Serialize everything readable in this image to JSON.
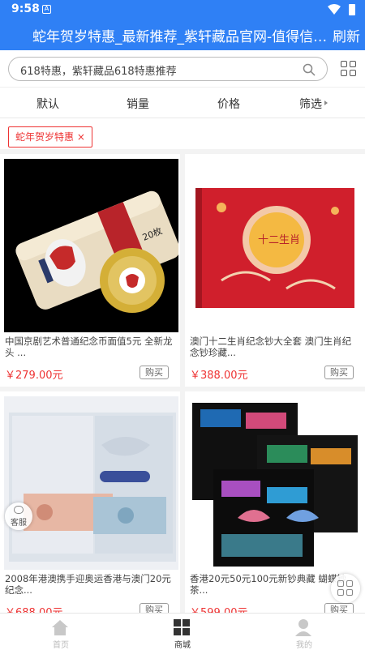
{
  "status_bar": {
    "time": "9:58"
  },
  "app_bar": {
    "title": "蛇年贺岁特惠_最新推荐_紫轩藏品官网-值得信赖的...",
    "refresh_label": "刷新"
  },
  "search": {
    "value": "618特惠，紫轩藏品618特惠推荐"
  },
  "sort_options": [
    "默认",
    "销量",
    "价格",
    "筛选"
  ],
  "filter_chip": "蛇年贺岁特惠 ×",
  "products": [
    {
      "name": "中国京剧艺术普通纪念币面值5元 全新龙头 ...",
      "price": "￥279.00元",
      "buy_label": "购买"
    },
    {
      "name": "澳门十二生肖纪念钞大全套 澳门生肖纪念钞珍藏...",
      "price": "￥388.00元",
      "buy_label": "购买"
    },
    {
      "name": "2008年港澳携手迎奥运香港与澳门20元纪念...",
      "price": "￥688.00元",
      "buy_label": "购买"
    },
    {
      "name": "香港20元50元100元新钞典藏 蝴蝶钞茶...",
      "price": "￥599.00元",
      "buy_label": "购买"
    }
  ],
  "product_image_text": {
    "p1_roll_mark": "20枚",
    "p2_book_title": "十二生肖"
  },
  "float": {
    "service_label": "客服"
  },
  "tabs": [
    {
      "label": "首页",
      "icon": "home-icon",
      "active": false
    },
    {
      "label": "商城",
      "icon": "store-icon",
      "active": true
    },
    {
      "label": "我的",
      "icon": "profile-icon",
      "active": false
    }
  ],
  "colors": {
    "brand": "#2f80f5",
    "price": "#e33333",
    "chip": "#e33333"
  }
}
